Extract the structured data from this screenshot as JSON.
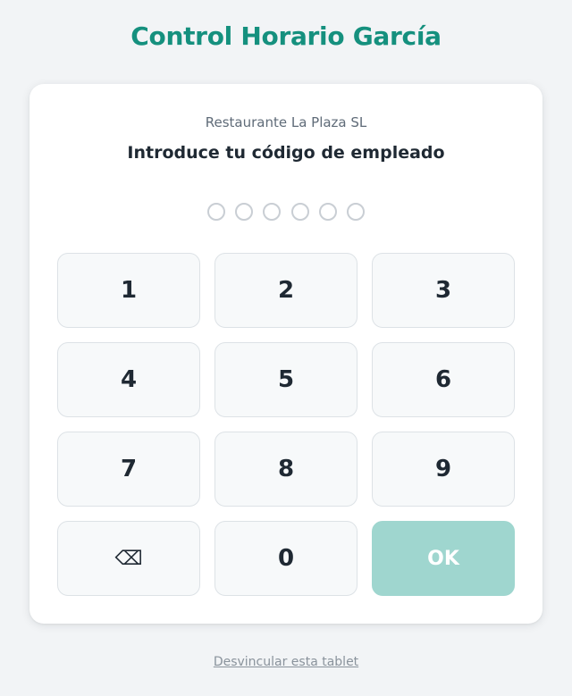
{
  "app": {
    "title": "Control Horario García"
  },
  "card": {
    "company_name": "Restaurante La Plaza SL",
    "prompt": "Introduce tu código de empleado",
    "pin_length": 6,
    "pin_filled": 0
  },
  "keypad": {
    "keys": [
      "1",
      "2",
      "3",
      "4",
      "5",
      "6",
      "7",
      "8",
      "9"
    ],
    "backspace_icon": "backspace-icon",
    "backspace_glyph": "⌫",
    "zero": "0",
    "ok_label": "OK"
  },
  "footer": {
    "unlink_label": "Desvincular esta tablet"
  },
  "colors": {
    "brand": "#15907e",
    "ok_disabled": "#9fd6cf",
    "background": "#f2f4f6"
  }
}
